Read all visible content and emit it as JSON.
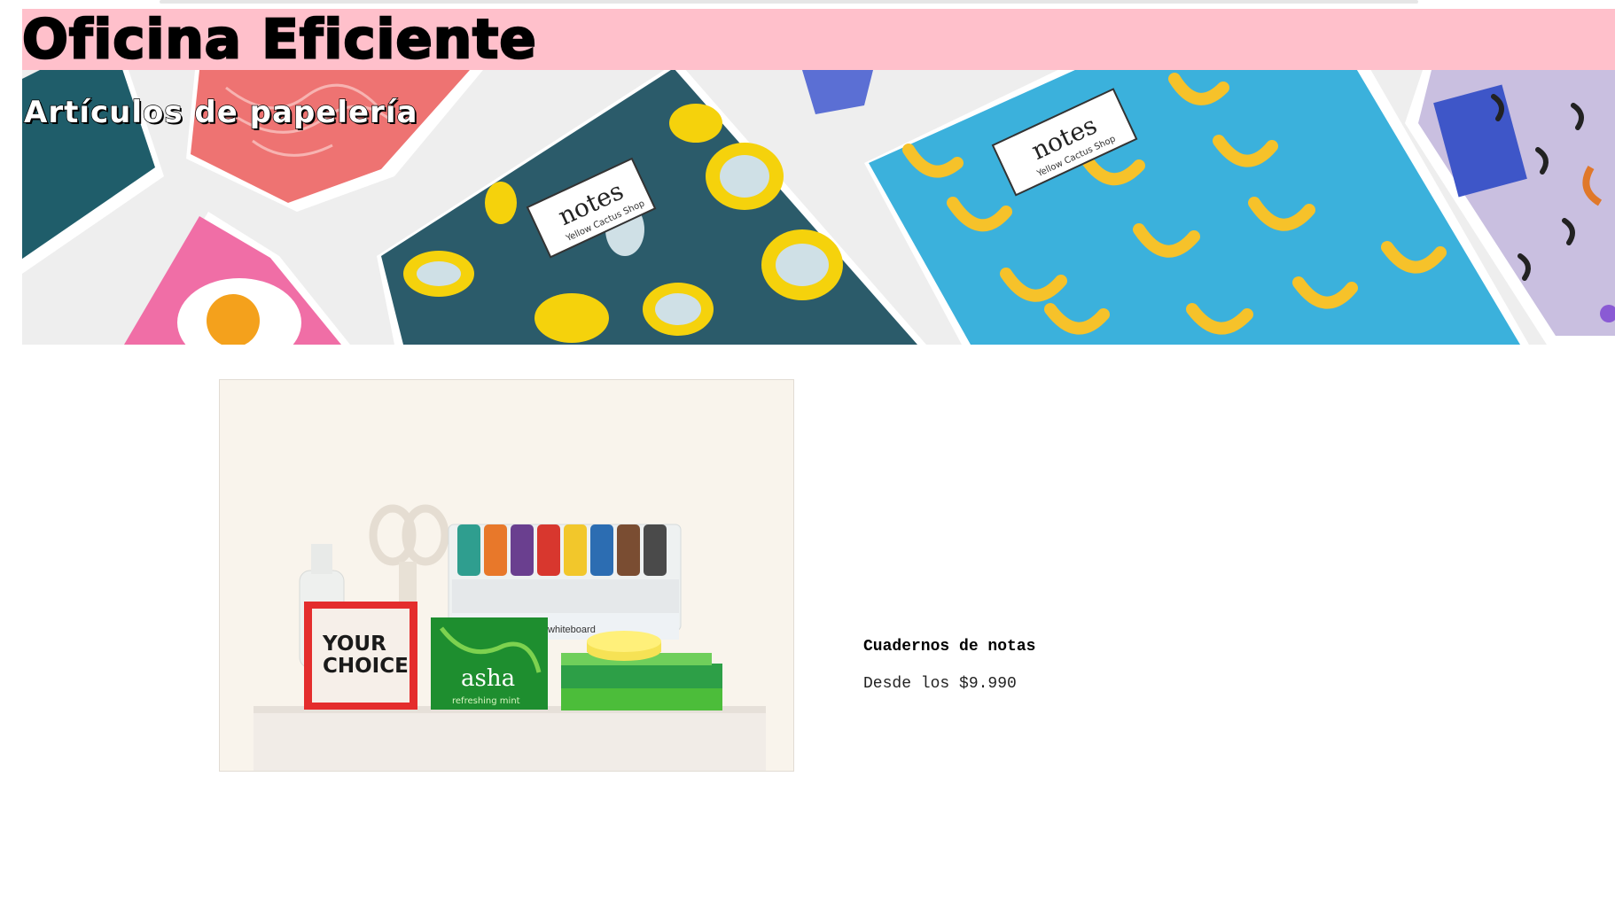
{
  "header": {
    "title": "Oficina Eficiente",
    "background_color": "#ffc0cb"
  },
  "hero": {
    "subtitle": "Artículos de papelería",
    "notebook_label": "notes",
    "notebook_brand": "Yellow Cactus Shop"
  },
  "product": {
    "name": "Cuadernos de notas",
    "price": "Desde los $9.990",
    "image_text": {
      "card": "YOUR\nCHOICE",
      "tea_brand": "asha",
      "tea_flavor": "refreshing mint",
      "whiteboard_label": "whiteboard"
    }
  }
}
